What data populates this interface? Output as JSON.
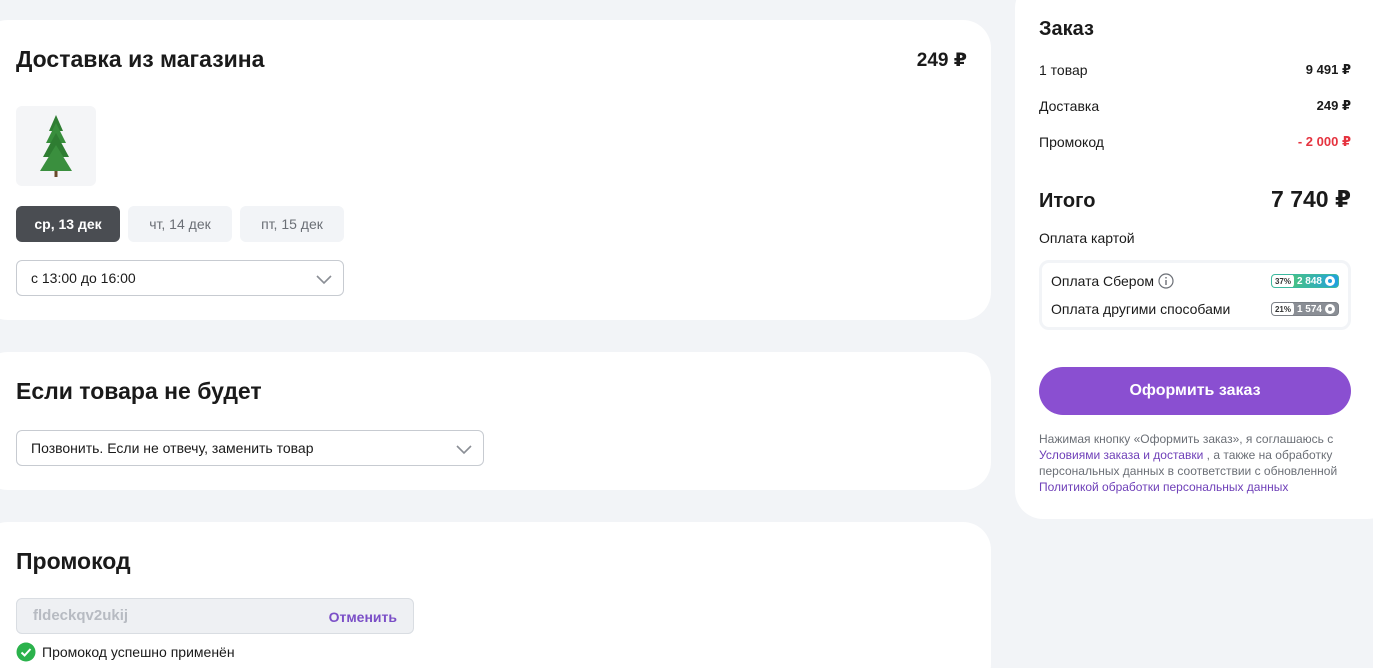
{
  "delivery": {
    "title": "Доставка из магазина",
    "price": "249 ₽",
    "dates": [
      {
        "label": "ср, 13 дек",
        "active": true
      },
      {
        "label": "чт, 14 дек",
        "active": false
      },
      {
        "label": "пт, 15 дек",
        "active": false
      }
    ],
    "time_slot": "с 13:00 до 16:00"
  },
  "missing": {
    "title": "Если товара не будет",
    "option": "Позвонить. Если не отвечу, заменить товар"
  },
  "promo": {
    "title": "Промокод",
    "code": "fldeckqv2ukij",
    "cancel_label": "Отменить",
    "success_text": "Промокод успешно применён"
  },
  "order": {
    "title": "Заказ",
    "items_label": "1 товар",
    "items_value": "9 491 ₽",
    "delivery_label": "Доставка",
    "delivery_value": "249 ₽",
    "promo_label": "Промокод",
    "promo_value": "- 2 000 ₽",
    "total_label": "Итого",
    "total_value": "7 740 ₽",
    "pay_caption": "Оплата картой",
    "pay_sber_label": "Оплата Сбером",
    "pay_sber_pct": "37%",
    "pay_sber_bonus": "2 848",
    "pay_other_label": "Оплата другими способами",
    "pay_other_pct": "21%",
    "pay_other_bonus": "1 574",
    "button_label": "Оформить заказ",
    "legal_prefix": "Нажимая кнопку «Оформить заказ», я соглашаюсь с",
    "legal_link1": "Условиями заказа и доставки",
    "legal_middle": ", а также на обработку персональных данных в соответствии с обновленной",
    "legal_link2": "Политикой обработки персональных данных"
  },
  "colors": {
    "accent": "#8a4fd1",
    "negative": "#e5333f",
    "success": "#2bb24c",
    "active_chip": "#4a4d52"
  }
}
